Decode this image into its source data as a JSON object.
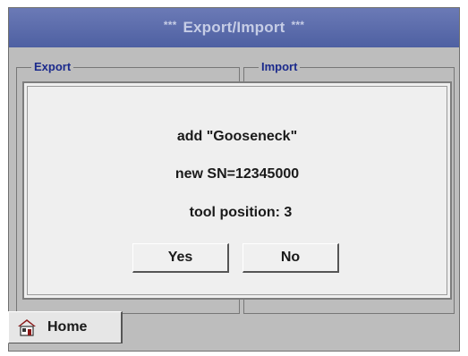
{
  "window": {
    "title": "Export/Import",
    "title_decoration": "***"
  },
  "groups": {
    "export_label": "Export",
    "import_label": "Import"
  },
  "dialog": {
    "line1": "add \"Gooseneck\"",
    "line2": "new SN=12345000",
    "line3": "tool position: 3",
    "yes_label": "Yes",
    "no_label": "No"
  },
  "footer": {
    "home_label": "Home",
    "home_icon": "house-icon"
  },
  "colors": {
    "titlebar": "#5a6cab",
    "title_text": "#c6cde6",
    "group_label": "#1b2a8c",
    "panel_bg": "#bdbdbd",
    "dialog_bg": "#efefef",
    "home_icon_roof": "#8b1a1a"
  }
}
